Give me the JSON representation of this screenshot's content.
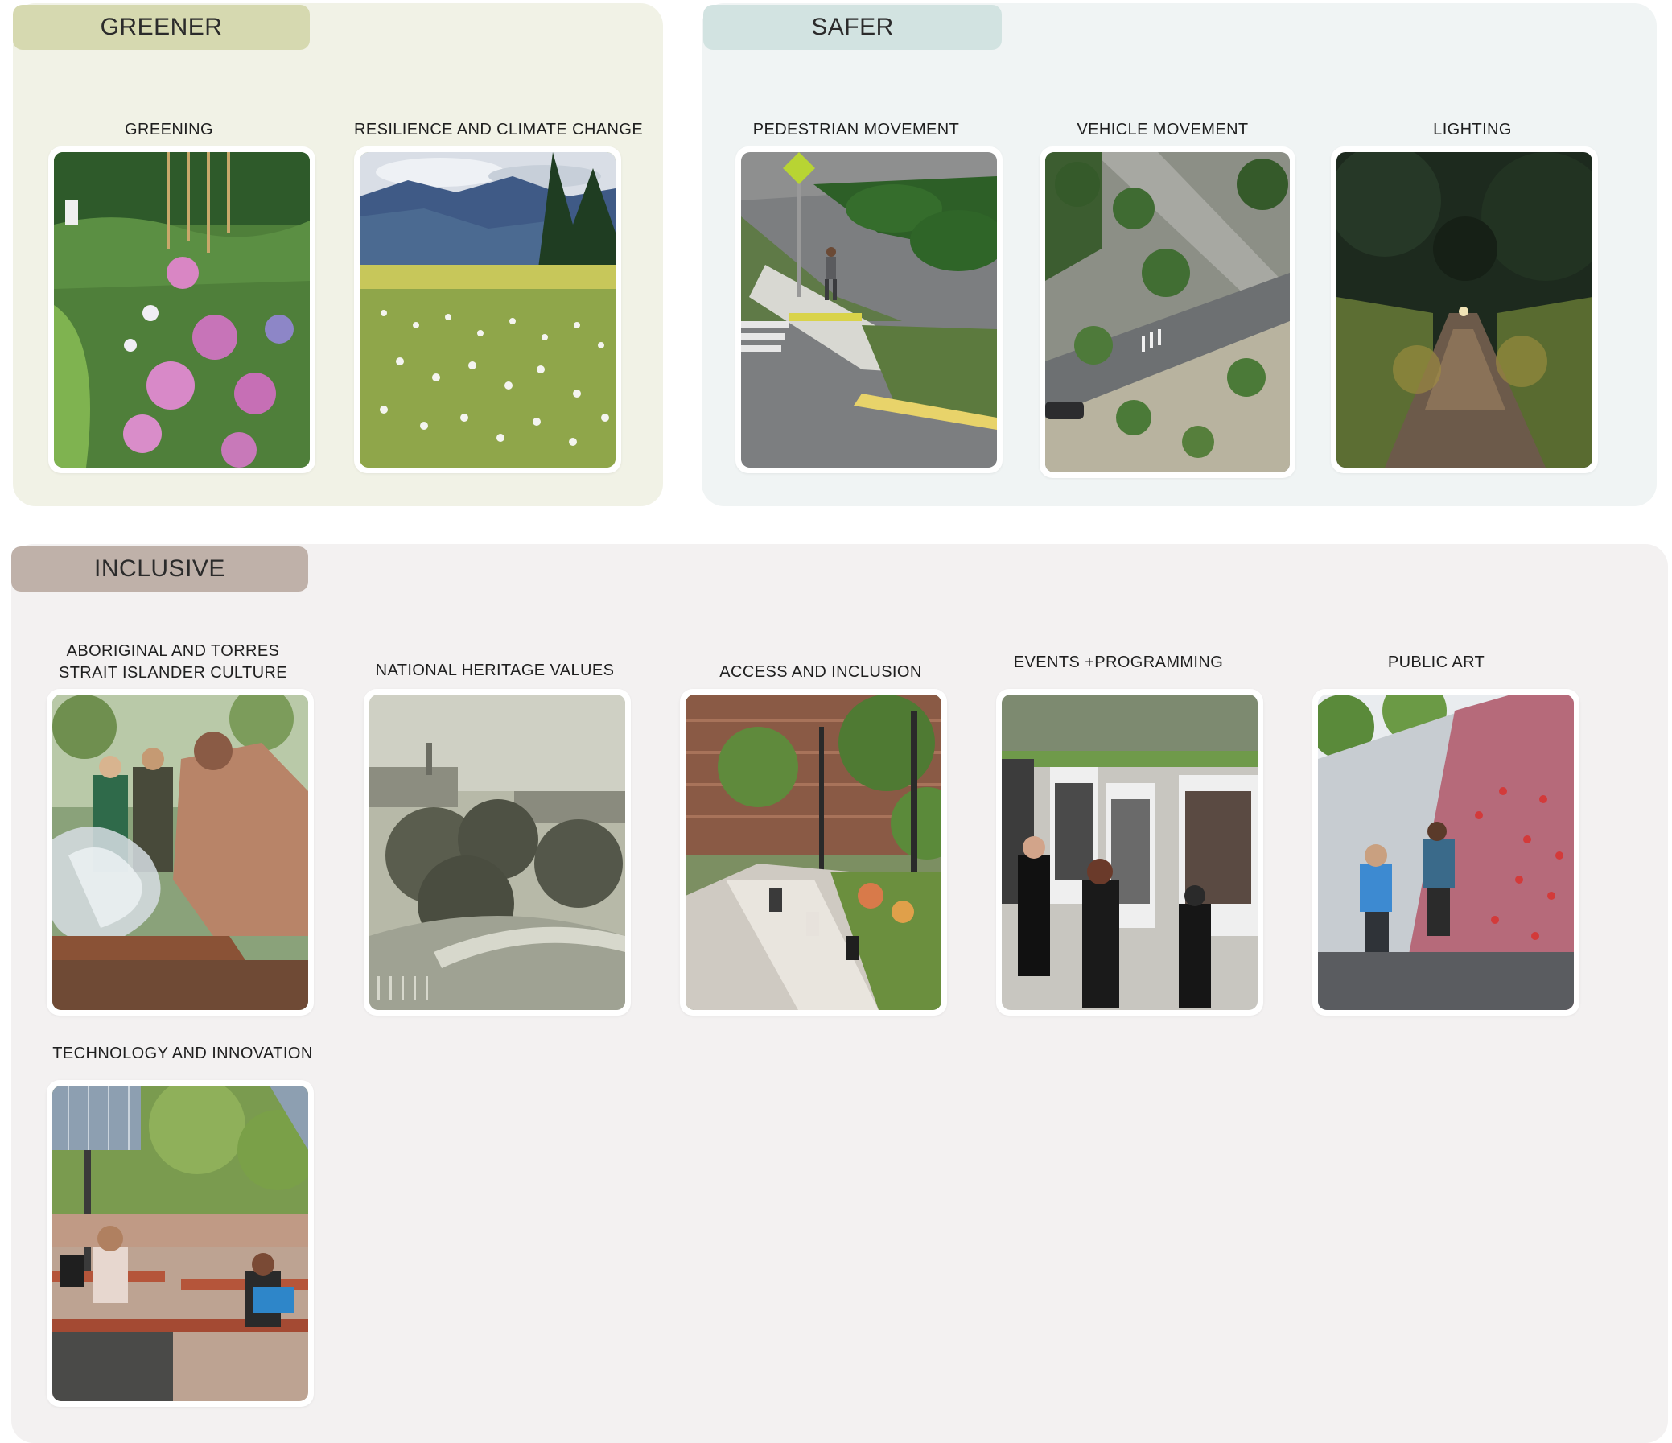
{
  "sections": {
    "greener": {
      "title": "GREENER",
      "color": "#d6d9b0",
      "panel_color": "#f1f2e6",
      "items": [
        {
          "label": "GREENING",
          "image": "flower-meadow-photo"
        },
        {
          "label": "RESILIENCE AND  CLIMATE CHANGE",
          "image": "alpine-meadow-photo"
        }
      ]
    },
    "safer": {
      "title": "SAFER",
      "color": "#d2e3e1",
      "panel_color": "#f0f4f4",
      "items": [
        {
          "label": "PEDESTRIAN MOVEMENT",
          "image": "pedestrian-crossing-photo"
        },
        {
          "label": "VEHICLE MOVEMENT",
          "image": "street-aerial-photo"
        },
        {
          "label": "LIGHTING",
          "image": "lit-path-photo"
        }
      ]
    },
    "inclusive": {
      "title": "INCLUSIVE",
      "color": "#bfb1a9",
      "panel_color": "#f3f1f1",
      "items": [
        {
          "label_lines": [
            "ABORIGINAL AND TORRES",
            "STRAIT ISLANDER CULTURE"
          ],
          "image": "smoking-ceremony-photo"
        },
        {
          "label": "NATIONAL HERITAGE VALUES",
          "image": "historic-park-photo"
        },
        {
          "label": "ACCESS AND INCLUSION",
          "image": "garden-seating-photo"
        },
        {
          "label": "EVENTS +PROGRAMMING",
          "image": "outdoor-exhibition-photo"
        },
        {
          "label": "PUBLIC ART",
          "image": "climbing-wall-art-photo"
        },
        {
          "label": "TECHNOLOGY AND INNOVATION",
          "image": "solar-plaza-photo"
        }
      ]
    }
  }
}
